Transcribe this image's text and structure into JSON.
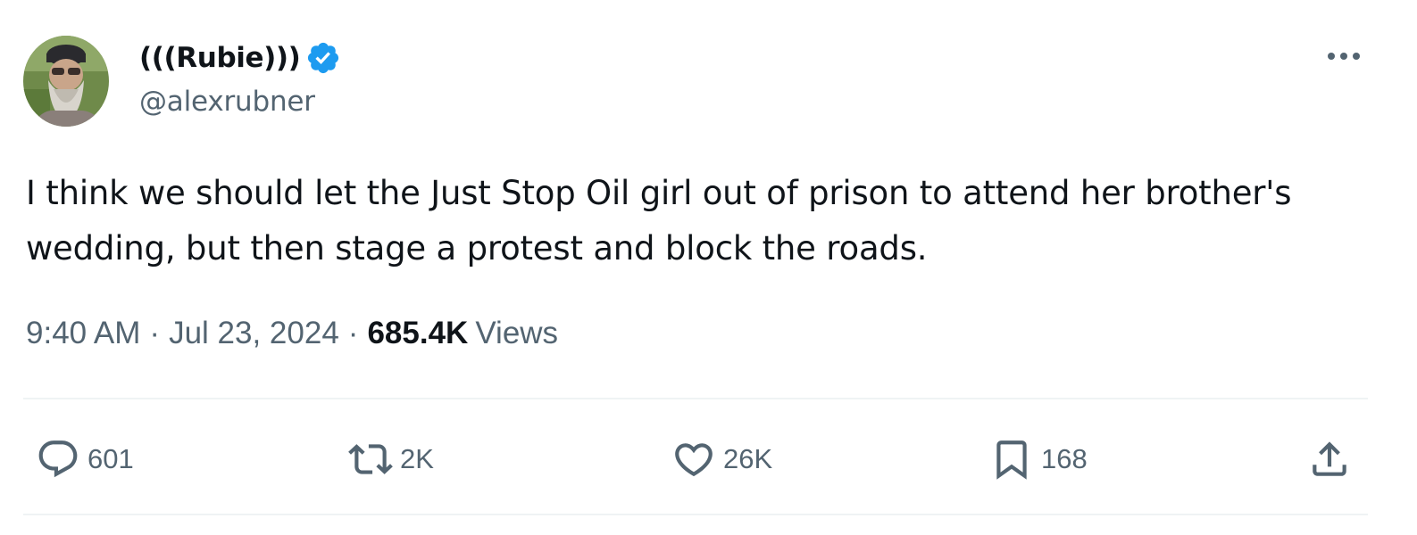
{
  "author": {
    "display_name": "(((Rubie)))",
    "handle": "@alexrubner",
    "verified": true,
    "avatar_icon": "avatar-photo",
    "verified_color": "#1d9bf0"
  },
  "tweet": {
    "text": "I think we should let the Just Stop Oil girl out of prison to attend her brother's wedding, but then stage a protest and block the roads.",
    "time": "9:40 AM",
    "date": "Jul 23, 2024",
    "separator": "·",
    "views_count": "685.4K",
    "views_label": "Views"
  },
  "actions": {
    "reply": {
      "icon": "reply-icon",
      "count": "601"
    },
    "retweet": {
      "icon": "retweet-icon",
      "count": "2K"
    },
    "like": {
      "icon": "heart-icon",
      "count": "26K"
    },
    "bookmark": {
      "icon": "bookmark-icon",
      "count": "168"
    },
    "share": {
      "icon": "share-icon"
    }
  },
  "colors": {
    "text_primary": "#0f1419",
    "text_secondary": "#536471",
    "divider": "#eff3f4"
  }
}
